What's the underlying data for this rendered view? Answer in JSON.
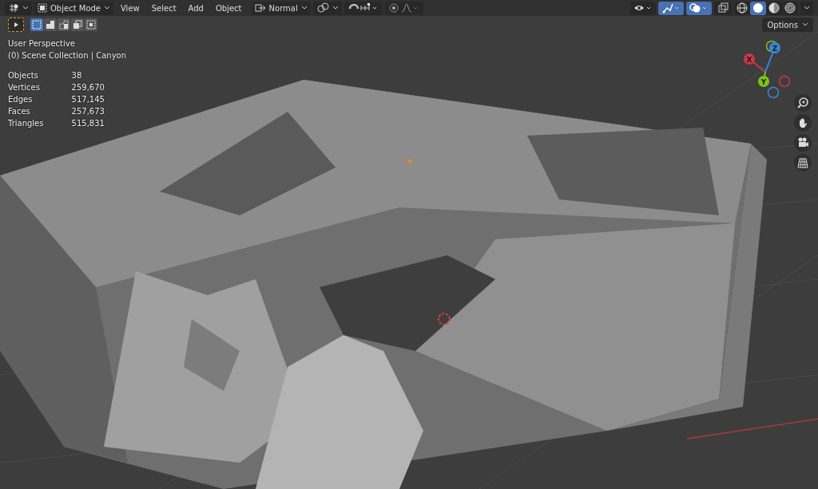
{
  "header": {
    "mode": "Object Mode",
    "menus": [
      "View",
      "Select",
      "Add",
      "Object"
    ],
    "orientation": "Normal"
  },
  "snap": {
    "on": false
  },
  "proportional": {
    "on": false
  },
  "overlay_toggles": [
    {
      "kind": "visibility",
      "on": false
    },
    {
      "kind": "gizmo",
      "on": true
    },
    {
      "kind": "overlay",
      "on": true
    },
    {
      "kind": "xray",
      "on": false
    }
  ],
  "shading_modes": [
    {
      "kind": "wireframe",
      "selected": false
    },
    {
      "kind": "solid",
      "selected": true
    },
    {
      "kind": "material",
      "selected": false
    },
    {
      "kind": "rendered",
      "selected": false
    }
  ],
  "tool": {
    "active": true
  },
  "select_modes": [
    {
      "selected": true
    },
    {
      "selected": false
    },
    {
      "selected": false
    },
    {
      "selected": false
    },
    {
      "selected": false
    }
  ],
  "options": "Options",
  "info": {
    "view": "User Perspective",
    "collection": "(0) Scene Collection | Canyon"
  },
  "stats": [
    {
      "label": "Objects",
      "value": "38"
    },
    {
      "label": "Vertices",
      "value": "259,670"
    },
    {
      "label": "Edges",
      "value": "517,145"
    },
    {
      "label": "Faces",
      "value": "257,673"
    },
    {
      "label": "Triangles",
      "value": "515,831"
    }
  ],
  "axes": [
    {
      "label": "X",
      "color": "#c9364b"
    },
    {
      "label": "Y",
      "color": "#7cc414"
    },
    {
      "label": "Z",
      "color": "#3a86d6"
    }
  ]
}
